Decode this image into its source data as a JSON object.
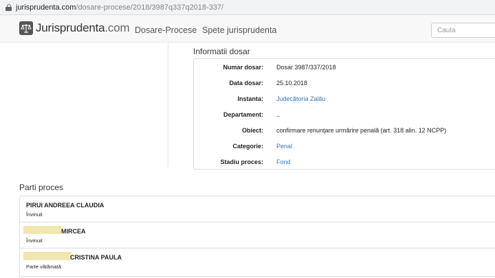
{
  "browser": {
    "url_host": "jurisprudenta.com",
    "url_path": "/dosare-procese/2018/3987q337q2018-337/"
  },
  "navbar": {
    "logo_main": "Jurisprudenta",
    "logo_suffix": ".com",
    "links": [
      "Dosare-Procese",
      "Spete jurisprudenta"
    ],
    "search_placeholder": "Cauta"
  },
  "info": {
    "title": "Informatii dosar",
    "rows": [
      {
        "label": "Numar dosar:",
        "value": "Dosar 3987/337/2018",
        "link": false
      },
      {
        "label": "Data dosar:",
        "value": "25.10.2018",
        "link": false
      },
      {
        "label": "Instanta:",
        "value": "Judecătoria Zalău",
        "link": true
      },
      {
        "label": "Departament:",
        "value": "..",
        "link": false
      },
      {
        "label": "Obiect:",
        "value": "confirmare renunţare urmărire penală (art. 318 alin. 12 NCPP)",
        "link": false
      },
      {
        "label": "Categorie:",
        "value": "Penal",
        "link": true
      },
      {
        "label": "Stadiu proces:",
        "value": "Fond",
        "link": true
      }
    ]
  },
  "parti": {
    "title": "Parti proces",
    "items": [
      {
        "name": "PIRUI ANDREEA CLAUDIA",
        "role": "Învinuit"
      },
      {
        "name": "MIRCEA",
        "role": "Învinuit"
      },
      {
        "name": "CRISTINA PAULA",
        "role": "Parte vătămată"
      }
    ]
  },
  "colors": {
    "link": "#337ab7",
    "navbar_bg": "#f8f8f8",
    "redaction": "#f2e6b0"
  }
}
